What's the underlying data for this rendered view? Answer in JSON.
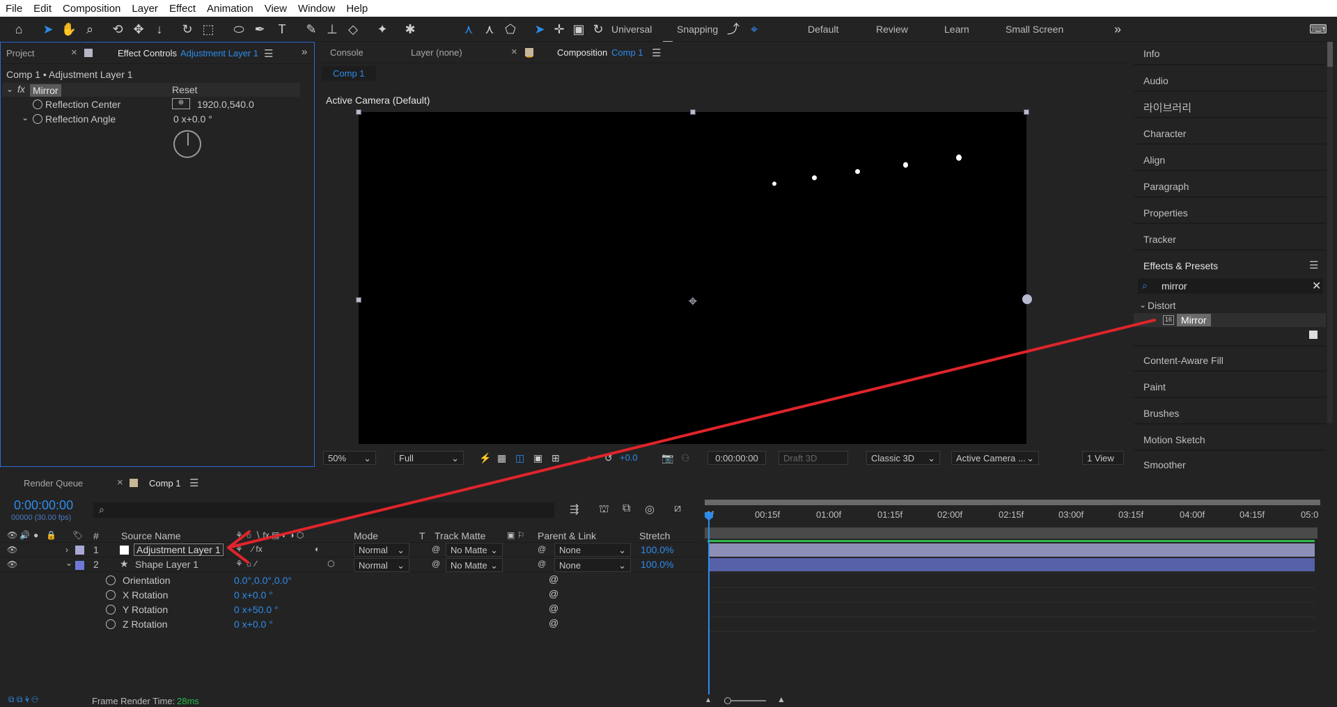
{
  "menu": [
    "File",
    "Edit",
    "Composition",
    "Layer",
    "Effect",
    "Animation",
    "View",
    "Window",
    "Help"
  ],
  "toolbar": {
    "universal_label": "Universal",
    "snapping_label": "Snapping",
    "workspaces": [
      "Default",
      "Review",
      "Learn",
      "Small Screen"
    ]
  },
  "left_panel": {
    "tabs": {
      "project": "Project",
      "effect_controls": "Effect Controls",
      "effect_controls_layer": "Adjustment Layer 1"
    },
    "breadcrumb": "Comp 1 • Adjustment Layer 1",
    "effect": {
      "name": "Mirror",
      "reset": "Reset",
      "props": [
        {
          "label": "Reflection Center",
          "value": "1920.0,540.0"
        },
        {
          "label": "Reflection Angle",
          "value": "0 x+0.0 °"
        }
      ]
    }
  },
  "comp_panel": {
    "tabs": {
      "console": "Console",
      "layer": "Layer (none)",
      "composition": "Composition",
      "comp_name": "Comp 1"
    },
    "subtab": "Comp 1",
    "camera_label": "Active Camera (Default)",
    "viewer": {
      "zoom": "50%",
      "resolution": "Full",
      "exposure": "+0.0",
      "timecode": "0:00:00:00",
      "draft3d": "Draft 3D",
      "renderer": "Classic 3D",
      "camera": "Active Camera ...",
      "views": "1 View"
    }
  },
  "right_panel": {
    "items": [
      "Info",
      "Audio",
      "라이브러리",
      "Character",
      "Align",
      "Paragraph",
      "Properties",
      "Tracker"
    ],
    "effects_presets_title": "Effects & Presets",
    "search_value": "mirror",
    "category": "Distort",
    "result": "Mirror",
    "lower_items": [
      "Content-Aware Fill",
      "Paint",
      "Brushes",
      "Motion Sketch",
      "Smoother"
    ]
  },
  "timeline": {
    "tabs": {
      "render_queue": "Render Queue",
      "comp": "Comp 1"
    },
    "timecode": "0:00:00:00",
    "fps": "00000 (30.00 fps)",
    "columns": {
      "num": "#",
      "source": "Source Name",
      "mode": "Mode",
      "t": "T",
      "track_matte": "Track Matte",
      "parent": "Parent & Link",
      "stretch": "Stretch"
    },
    "layers": [
      {
        "num": "1",
        "name": "Adjustment Layer 1",
        "mode": "Normal",
        "matte": "No Matte",
        "parent": "None",
        "stretch": "100.0%"
      },
      {
        "num": "2",
        "name": "Shape Layer 1",
        "mode": "Normal",
        "matte": "No Matte",
        "parent": "None",
        "stretch": "100.0%"
      }
    ],
    "props": [
      {
        "label": "Orientation",
        "value": "0.0°,0.0°,0.0°"
      },
      {
        "label": "X Rotation",
        "value": "0 x+0.0 °"
      },
      {
        "label": "Y Rotation",
        "value": "0 x+50.0 °"
      },
      {
        "label": "Z Rotation",
        "value": "0 x+0.0 °"
      }
    ],
    "ruler": [
      "0f",
      "00:15f",
      "01:00f",
      "01:15f",
      "02:00f",
      "02:15f",
      "03:00f",
      "03:15f",
      "04:00f",
      "04:15f",
      "05:0"
    ],
    "footer_label": "Frame Render Time:",
    "footer_value": "28ms"
  },
  "colors": {
    "accent": "#2d8ceb",
    "arrow": "#e0242b",
    "layer_bar_adj": "#8e8fb6",
    "layer_bar_shape": "#5661a8",
    "swatch_adj": "#ffffff",
    "swatch_label1": "#a9a9d8",
    "swatch_label2": "#6f7ad8"
  }
}
